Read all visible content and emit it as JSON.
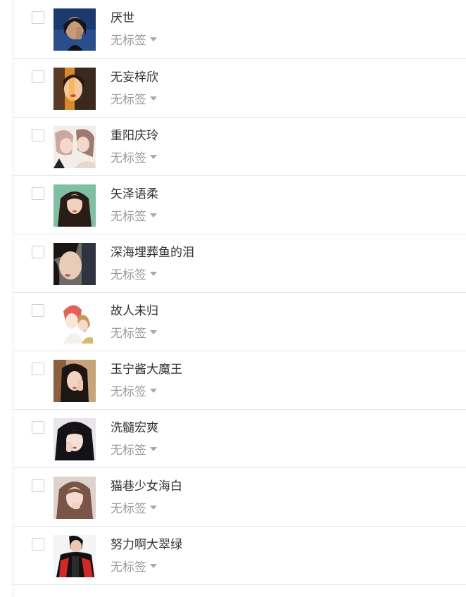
{
  "contacts": [
    {
      "name": "厌世",
      "tag": "无标签",
      "avatar_icon": "avatar-portrait-dark-blue"
    },
    {
      "name": "无妄梓欣",
      "tag": "无标签",
      "avatar_icon": "avatar-portrait-orange-light"
    },
    {
      "name": "重阳庆玲",
      "tag": "无标签",
      "avatar_icon": "avatar-anime-couple"
    },
    {
      "name": "矢泽语柔",
      "tag": "无标签",
      "avatar_icon": "avatar-portrait-green-bg"
    },
    {
      "name": "深海埋葬鱼的泪",
      "tag": "无标签",
      "avatar_icon": "avatar-portrait-closeup"
    },
    {
      "name": "故人未归",
      "tag": "无标签",
      "avatar_icon": "avatar-anime-redhair"
    },
    {
      "name": "玉宁酱大魔王",
      "tag": "无标签",
      "avatar_icon": "avatar-portrait-warm"
    },
    {
      "name": "洗髓宏爽",
      "tag": "无标签",
      "avatar_icon": "avatar-portrait-dark-hair"
    },
    {
      "name": "猫巷少女海白",
      "tag": "无标签",
      "avatar_icon": "avatar-portrait-soft"
    },
    {
      "name": "努力啊大翠绿",
      "tag": "无标签",
      "avatar_icon": "avatar-person-black-jacket"
    }
  ]
}
